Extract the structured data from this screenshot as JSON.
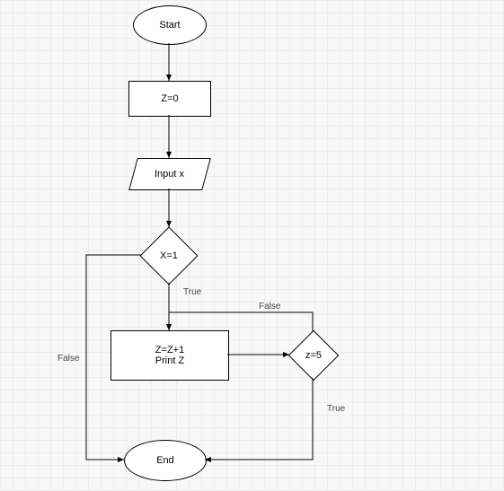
{
  "nodes": {
    "start": {
      "label": "Start"
    },
    "init": {
      "label": "Z=0"
    },
    "input": {
      "label": "Input x"
    },
    "cond1": {
      "label": "X=1"
    },
    "proc": {
      "label1": "Z=Z+1",
      "label2": "Print Z"
    },
    "cond2": {
      "label": "z=5"
    },
    "end": {
      "label": "End"
    }
  },
  "edge_labels": {
    "cond1_true": "True",
    "cond1_false": "False",
    "cond2_true": "True",
    "cond2_false": "False"
  }
}
